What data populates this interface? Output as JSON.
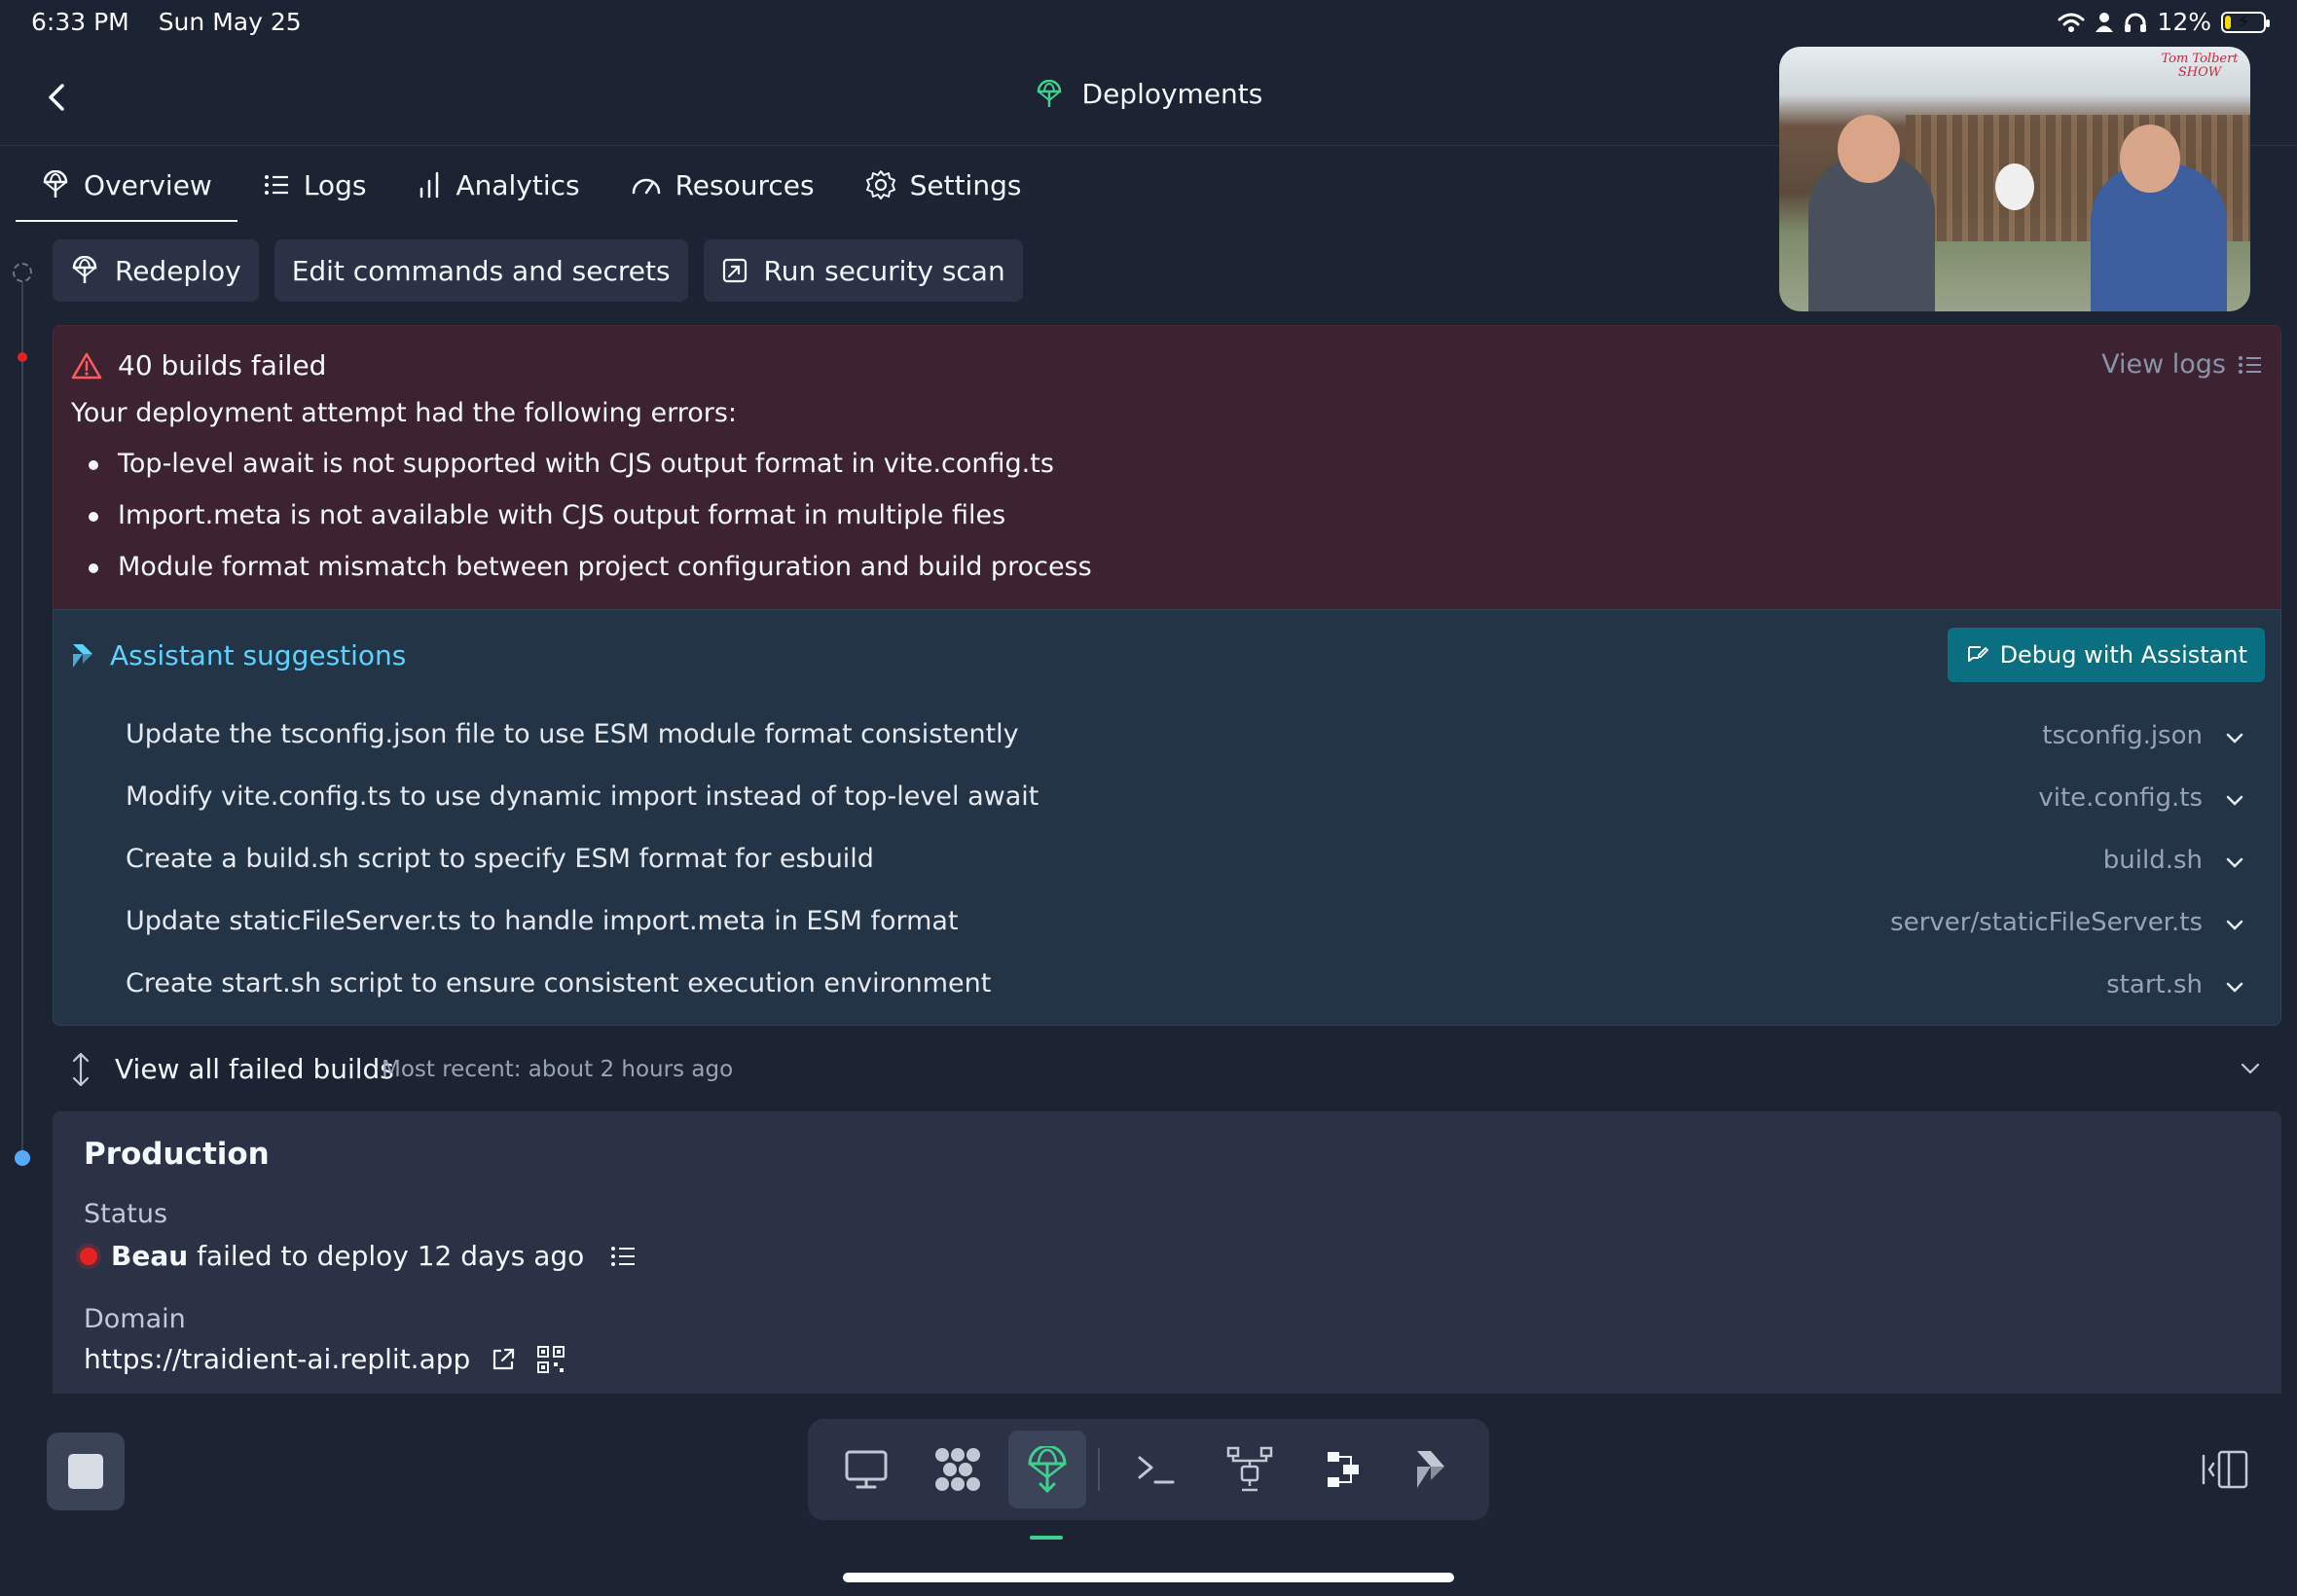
{
  "status_bar": {
    "time": "6:33 PM",
    "date": "Sun May 25",
    "battery": "12%",
    "icons": [
      "wifi-icon",
      "person-icon",
      "headphones-icon",
      "battery-charging-icon"
    ]
  },
  "header": {
    "title": "Deployments",
    "back_icon": "chevron-left-icon",
    "title_icon": "deployments-icon"
  },
  "pip": {
    "logo_text": "Tom Tolbert SHOW"
  },
  "tabs": [
    {
      "label": "Overview",
      "icon": "deployments-icon",
      "active": true
    },
    {
      "label": "Logs",
      "icon": "list-icon",
      "active": false
    },
    {
      "label": "Analytics",
      "icon": "bar-chart-icon",
      "active": false
    },
    {
      "label": "Resources",
      "icon": "gauge-icon",
      "active": false
    },
    {
      "label": "Settings",
      "icon": "gear-icon",
      "active": false
    }
  ],
  "actions": {
    "redeploy": "Redeploy",
    "edit": "Edit commands and secrets",
    "scan": "Run security scan"
  },
  "error_panel": {
    "title": "40 builds failed",
    "view_logs": "View logs",
    "intro": "Your deployment attempt had the following errors:",
    "errors": [
      "Top-level await is not supported with CJS output format in vite.config.ts",
      "Import.meta is not available with CJS output format in multiple files",
      "Module format mismatch between project configuration and build process"
    ]
  },
  "assistant": {
    "title": "Assistant suggestions",
    "debug_button": "Debug with Assistant",
    "suggestions": [
      {
        "text": "Update the tsconfig.json file to use ESM module format consistently",
        "file": "tsconfig.json"
      },
      {
        "text": "Modify vite.config.ts to use dynamic import instead of top-level await",
        "file": "vite.config.ts"
      },
      {
        "text": "Create a build.sh script to specify ESM format for esbuild",
        "file": "build.sh"
      },
      {
        "text": "Update staticFileServer.ts to handle import.meta in ESM format",
        "file": "server/staticFileServer.ts"
      },
      {
        "text": "Create start.sh script to ensure consistent execution environment",
        "file": "start.sh"
      }
    ]
  },
  "failed_builds": {
    "title": "View all failed builds",
    "subtitle": "Most recent: about 2 hours ago"
  },
  "production": {
    "title": "Production",
    "status_label": "Status",
    "status_user": "Beau",
    "status_text": "failed to deploy 12 days ago",
    "domain_label": "Domain",
    "domain": "https://traidient-ai.replit.app"
  },
  "dock": {
    "items": [
      "webview-icon",
      "packages-icon",
      "deployments-icon",
      "shell-icon",
      "git-icon",
      "workflows-icon",
      "assistant-icon"
    ],
    "active": "deployments-icon"
  },
  "colors": {
    "background": "#1c2333",
    "panel": "#2b3245",
    "error_bg": "#3d2232",
    "assist_bg": "#233447",
    "accent_blue": "#5ed2ff",
    "debug_button": "#0a6f80",
    "status_red": "#e52222",
    "deploy_green": "#3fcf8e"
  }
}
